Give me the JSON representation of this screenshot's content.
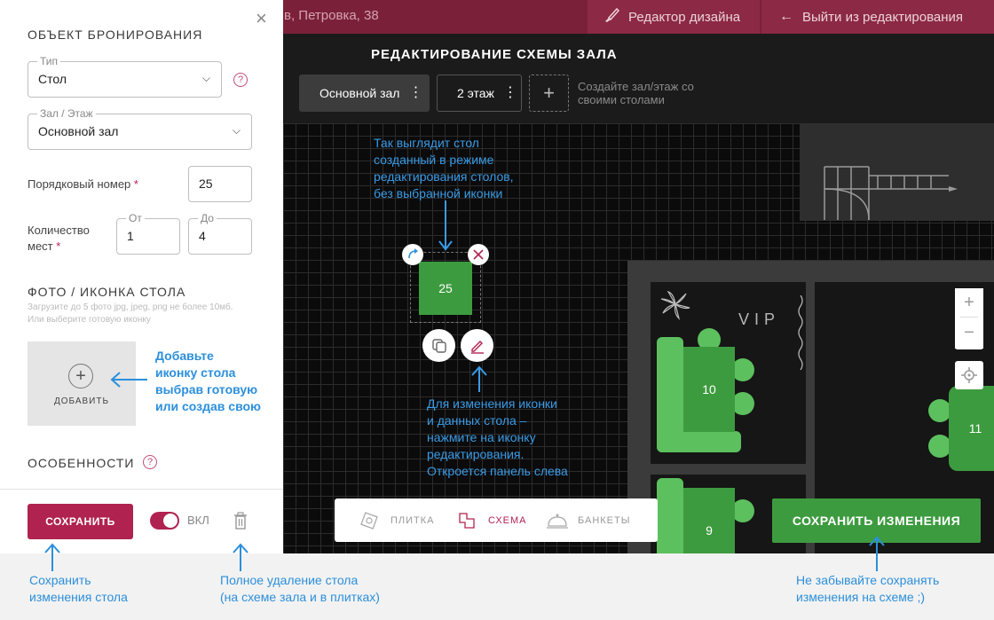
{
  "topbar": {
    "address": "в, Петровка, 38",
    "design_editor_label": "Редактор дизайна",
    "exit_editing_label": "Выйти из редактирования"
  },
  "header": {
    "title": "РЕДАКТИРОВАНИЕ СХЕМЫ ЗАЛА",
    "halls": [
      {
        "label": "Основной зал",
        "active": true
      },
      {
        "label": "2 этаж",
        "active": false
      }
    ],
    "add_hint": "Создайте зал/этаж со своими столами"
  },
  "panel": {
    "title": "ОБЪЕКТ БРОНИРОВАНИЯ",
    "type_label": "Тип",
    "type_value": "Стол",
    "hall_label": "Зал / Этаж",
    "hall_value": "Основной зал",
    "number_label": "Порядковый номер",
    "number_value": "25",
    "seats_label_line1": "Количество",
    "seats_label_line2": "мест",
    "seats_from_label": "От",
    "seats_from_value": "1",
    "seats_to_label": "До",
    "seats_to_value": "4",
    "photo_title": "ФОТО / ИКОНКА СТОЛА",
    "photo_hint_line1": "Загрузите до 5 фото jpg, jpeg, png не более 10мб.",
    "photo_hint_line2": "Или выберите готовую иконку",
    "add_label": "ДОБАВИТЬ",
    "features_title": "ОСОБЕННОСТИ",
    "save_label": "СОХРАНИТЬ",
    "toggle_label": "ВКЛ"
  },
  "plan": {
    "tables": [
      {
        "number": "25"
      },
      {
        "number": "10"
      },
      {
        "number": "11"
      },
      {
        "number": "9"
      }
    ],
    "vip_label": "VIP"
  },
  "modes": [
    {
      "label": "ПЛИТКА",
      "active": false
    },
    {
      "label": "СХЕМА",
      "active": true
    },
    {
      "label": "БАНКЕТЫ",
      "active": false
    }
  ],
  "save_changes_label": "СОХРАНИТЬ ИЗМЕНЕНИЯ",
  "notes": {
    "table_created": [
      "Так выглядит стол",
      "созданный в режиме",
      "редактирования столов,",
      "без выбранной иконки"
    ],
    "add_icon": [
      "Добавьте",
      "иконку стола",
      "выбрав готовую",
      "или создав свою"
    ],
    "edit_icon": [
      "Для изменения иконки",
      "и данных стола –",
      "нажмите на иконку",
      "редактирования.",
      "Откроется панель слева"
    ],
    "save_table": [
      "Сохранить",
      "изменения стола"
    ],
    "delete_table": [
      "Полное удаление стола",
      "(на схеме зала и в плитках)"
    ],
    "save_scheme": [
      "Не забывайте сохранять",
      "изменения на схеме ;)"
    ]
  },
  "colors": {
    "brand": "#b0224f",
    "topbar": "#7a2139",
    "table_green": "#3d9b3f",
    "note_blue": "#2c8fdb"
  }
}
